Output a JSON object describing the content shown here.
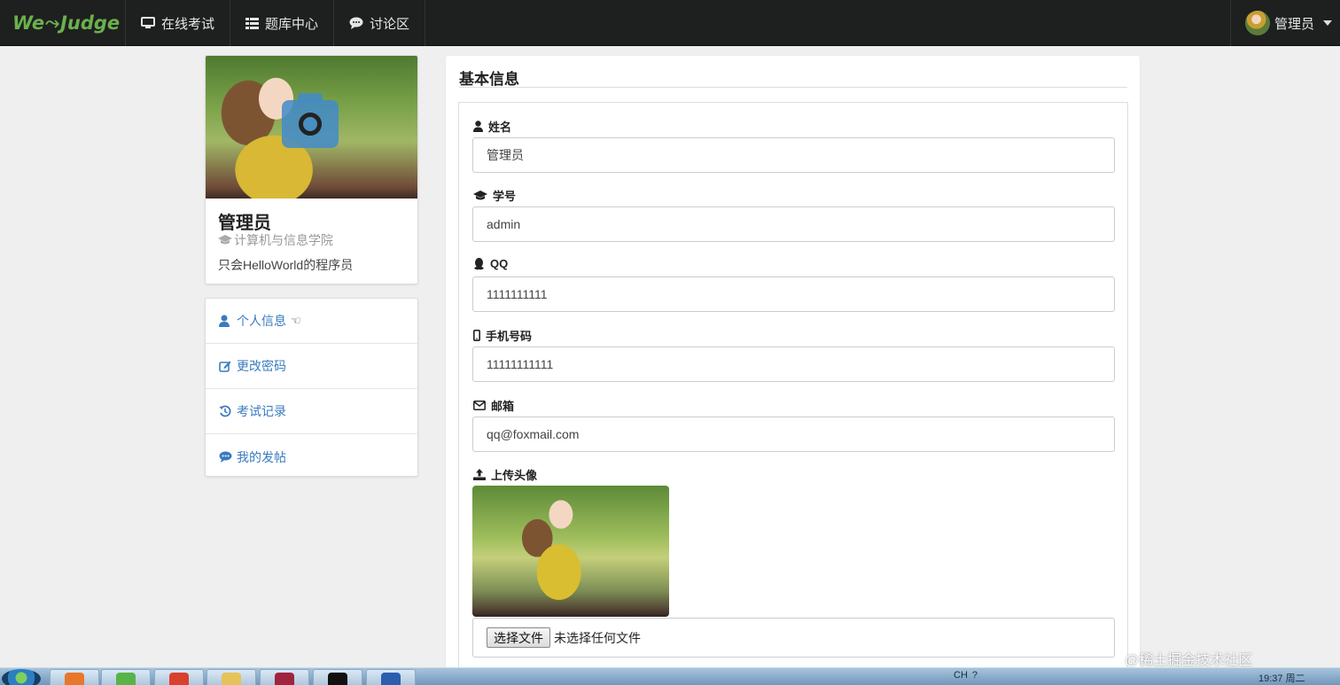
{
  "navbar": {
    "brand_we": "We",
    "brand_mark": "⤳",
    "brand_judge": "Judge",
    "items": [
      {
        "label": "在线考试",
        "icon": "monitor-icon"
      },
      {
        "label": "题库中心",
        "icon": "list-icon"
      },
      {
        "label": "讨论区",
        "icon": "comment-icon"
      }
    ],
    "user_label": "管理员"
  },
  "profile": {
    "name": "管理员",
    "school": "计算机与信息学院",
    "bio": "只会HelloWorld的程序员",
    "photo_icon": "camera-icon"
  },
  "side_menu": {
    "items": [
      {
        "label": "个人信息",
        "icon": "user-icon",
        "pointer": "☜"
      },
      {
        "label": "更改密码",
        "icon": "edit-icon"
      },
      {
        "label": "考试记录",
        "icon": "history-icon"
      },
      {
        "label": "我的发帖",
        "icon": "comments-icon"
      }
    ]
  },
  "main": {
    "title": "基本信息",
    "fields": {
      "name": {
        "label": "姓名",
        "value": "管理员",
        "icon": "user-icon"
      },
      "student_id": {
        "label": "学号",
        "value": "admin",
        "icon": "graduation-cap-icon"
      },
      "qq": {
        "label": "QQ",
        "value": "1111111111",
        "icon": "qq-icon"
      },
      "phone": {
        "label": "手机号码",
        "value": "11111111111",
        "icon": "mobile-icon"
      },
      "email": {
        "label": "邮箱",
        "value": "qq@foxmail.com",
        "icon": "envelope-icon"
      }
    },
    "upload": {
      "label": "上传头像",
      "icon": "upload-icon",
      "button_label": "选择文件",
      "file_status": "未选择任何文件"
    }
  },
  "taskbar": {
    "tray_text": [
      "CH",
      "?"
    ],
    "clock": "19:37 周二"
  },
  "watermark": {
    "text": "@稀土掘金技术社区",
    "url": "https://blog.csdn.net/weixin_46..."
  },
  "colors": {
    "navbar_bg": "#1e1f1f",
    "brand_green": "#6ab04c",
    "link_blue": "#3a7bbf",
    "page_bg": "#efefef"
  }
}
